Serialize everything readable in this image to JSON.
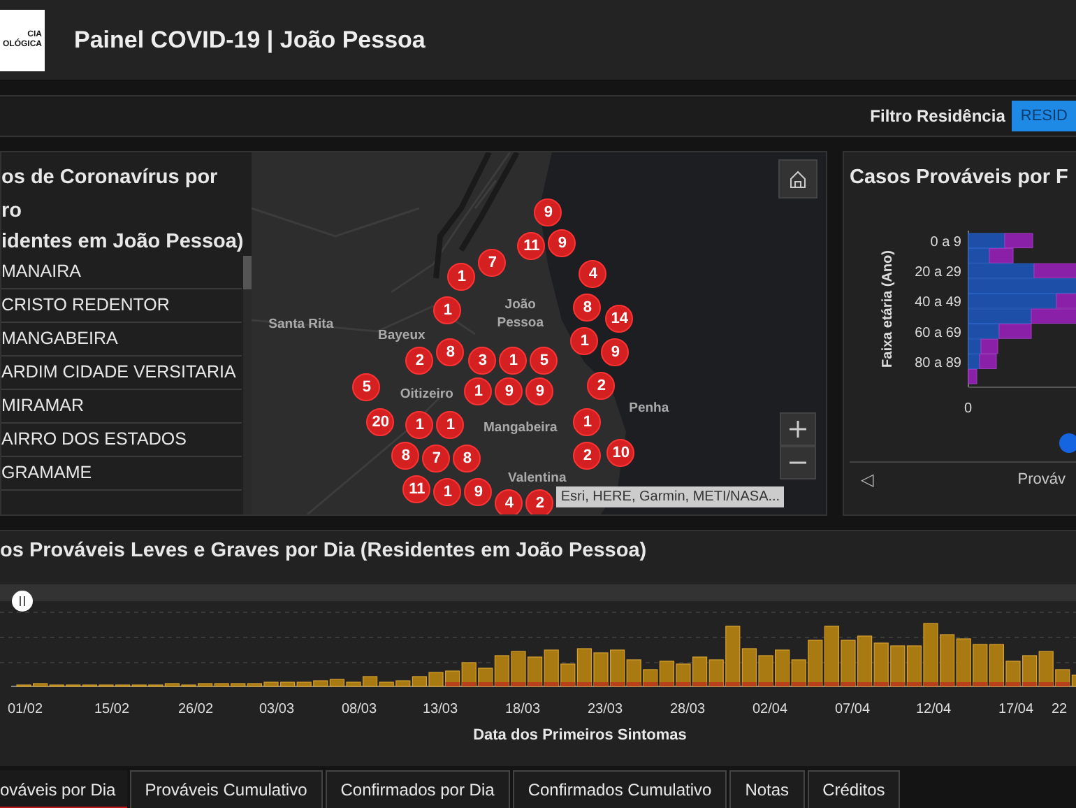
{
  "header": {
    "logo_text": [
      "CIA",
      "OLÓGICA"
    ],
    "title": "Painel COVID-19 | João Pessoa"
  },
  "filter_bar": {
    "label": "Filtro Residência",
    "button": "RESID"
  },
  "neighborhood_panel": {
    "title_lines": [
      "os de Coronavírus por",
      "ro",
      "identes em João Pessoa)"
    ],
    "items": [
      {
        "label": "MANAIRA"
      },
      {
        "label": "CRISTO REDENTOR"
      },
      {
        "label": "MANGABEIRA"
      },
      {
        "label": "ARDIM CIDADE VERSITARIA"
      },
      {
        "label": "MIRAMAR"
      },
      {
        "label": "AIRRO DOS ESTADOS"
      },
      {
        "label": "GRAMAME"
      }
    ]
  },
  "map": {
    "places": [
      {
        "label": "Santa Rita"
      },
      {
        "label": "Bayeux"
      },
      {
        "label": "João"
      },
      {
        "label": "Pessoa"
      },
      {
        "label": "Oitizeiro"
      },
      {
        "label": "Penha"
      },
      {
        "label": "Mangabeira"
      },
      {
        "label": "Valentina"
      }
    ],
    "markers": [
      {
        "label": "9"
      },
      {
        "label": "11"
      },
      {
        "label": "9"
      },
      {
        "label": "1"
      },
      {
        "label": "7"
      },
      {
        "label": "4"
      },
      {
        "label": "1"
      },
      {
        "label": "8"
      },
      {
        "label": "14"
      },
      {
        "label": "1"
      },
      {
        "label": "2"
      },
      {
        "label": "8"
      },
      {
        "label": "3"
      },
      {
        "label": "1"
      },
      {
        "label": "5"
      },
      {
        "label": "9"
      },
      {
        "label": "5"
      },
      {
        "label": "1"
      },
      {
        "label": "9"
      },
      {
        "label": "9"
      },
      {
        "label": "2"
      },
      {
        "label": "20"
      },
      {
        "label": "1"
      },
      {
        "label": "1"
      },
      {
        "label": "1"
      },
      {
        "label": "8"
      },
      {
        "label": "7"
      },
      {
        "label": "8"
      },
      {
        "label": "2"
      },
      {
        "label": "10"
      },
      {
        "label": "11"
      },
      {
        "label": "1"
      },
      {
        "label": "9"
      },
      {
        "label": "4"
      },
      {
        "label": "2"
      }
    ],
    "attribution": "Esri, HERE, Garmin, METI/NASA..."
  },
  "age_panel": {
    "title": "Casos Prováveis por F",
    "axis_title": "Faixa etária (Ano)",
    "age_labels": [
      "0 a 9",
      "20 a 29",
      "40 a 49",
      "60 a 69",
      "80 a 89"
    ],
    "x_tick": "0",
    "nav_prev": "◁",
    "nav_label": "Prováv"
  },
  "daily_panel": {
    "title": "os Prováveis Leves e Graves por Dia (Residentes em João Pessoa)",
    "x_tick_labels": [
      "01/02",
      "15/02",
      "26/02",
      "03/03",
      "08/03",
      "13/03",
      "18/03",
      "23/03",
      "28/03",
      "02/04",
      "07/04",
      "12/04",
      "17/04",
      "22"
    ],
    "xlabel": "Data dos Primeiros Sintomas"
  },
  "tabs": [
    {
      "label": "ováveis por Dia",
      "selected": true
    },
    {
      "label": "Prováveis Cumulativo",
      "selected": false
    },
    {
      "label": "Confirmados por Dia",
      "selected": false
    },
    {
      "label": "Confirmados Cumulativo",
      "selected": false
    },
    {
      "label": "Notas",
      "selected": false
    },
    {
      "label": "Créditos",
      "selected": false
    }
  ]
}
